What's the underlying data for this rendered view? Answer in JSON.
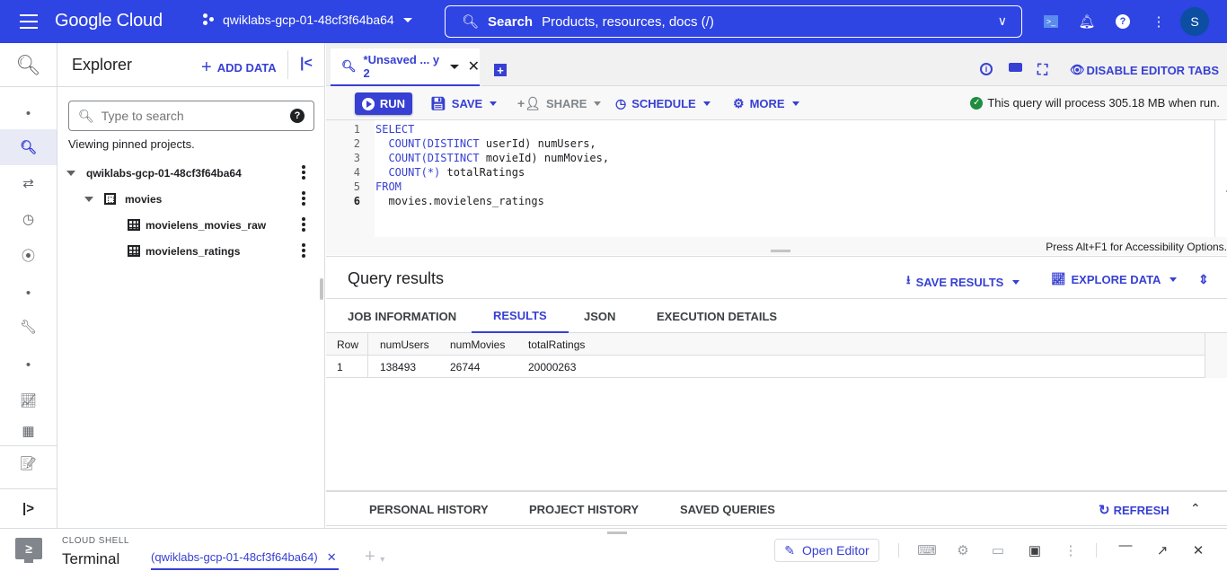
{
  "topbar": {
    "logo": "Google Cloud",
    "project": "qwiklabs-gcp-01-48cf3f64ba64",
    "search_label": "Search",
    "search_placeholder": "Products, resources, docs (/)",
    "avatar_initial": "S",
    "brand_color": "#2e44e3"
  },
  "explorer": {
    "title": "Explorer",
    "add_data": "ADD DATA",
    "search_placeholder": "Type to search",
    "viewing_text": "Viewing pinned projects.",
    "tree": [
      {
        "label": "qwiklabs-gcp-01-48cf3f64ba64",
        "type": "project"
      },
      {
        "label": "movies",
        "type": "dataset"
      },
      {
        "label": "movielens_movies_raw",
        "type": "table"
      },
      {
        "label": "movielens_ratings",
        "type": "table"
      }
    ]
  },
  "editor": {
    "tab_label": "*Unsaved ... y 2",
    "toolbar": {
      "run": "RUN",
      "save": "SAVE",
      "share": "SHARE",
      "schedule": "SCHEDULE",
      "more": "MORE",
      "disable_tabs": "DISABLE EDITOR TABS"
    },
    "validation": "This query will process 305.18 MB when run.",
    "lines": [
      {
        "n": "1",
        "kw": "SELECT",
        "rest": ""
      },
      {
        "n": "2",
        "kw": "  COUNT(DISTINCT",
        "rest": " userId) numUsers,"
      },
      {
        "n": "3",
        "kw": "  COUNT(DISTINCT",
        "rest": " movieId) numMovies,"
      },
      {
        "n": "4",
        "kw": "  COUNT(*)",
        "rest": " totalRatings"
      },
      {
        "n": "5",
        "kw": "FROM",
        "rest": ""
      },
      {
        "n": "6",
        "kw": "",
        "rest": "  movies.movielens_ratings"
      }
    ],
    "accessibility_hint": "Press Alt+F1 for Accessibility Options."
  },
  "results": {
    "title": "Query results",
    "save_results": "SAVE RESULTS",
    "explore_data": "EXPLORE DATA",
    "tabs": [
      "JOB INFORMATION",
      "RESULTS",
      "JSON",
      "EXECUTION DETAILS"
    ],
    "active_tab": "RESULTS",
    "columns": [
      "Row",
      "numUsers",
      "numMovies",
      "totalRatings"
    ],
    "rows": [
      [
        "1",
        "138493",
        "26744",
        "20000263"
      ]
    ]
  },
  "history": {
    "tabs": [
      "PERSONAL HISTORY",
      "PROJECT HISTORY",
      "SAVED QUERIES"
    ],
    "refresh": "REFRESH"
  },
  "cloud_shell": {
    "label": "CLOUD SHELL",
    "terminal": "Terminal",
    "tab": "(qwiklabs-gcp-01-48cf3f64ba64)",
    "open_editor": "Open Editor"
  }
}
